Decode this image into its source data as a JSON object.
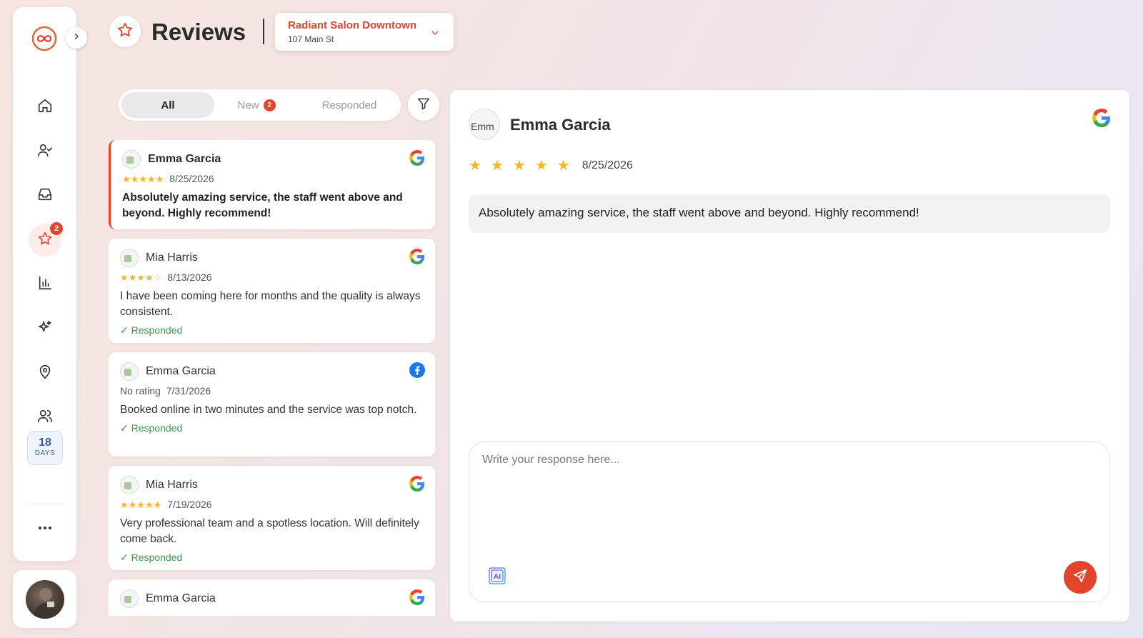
{
  "sidebar": {
    "items": [
      {
        "name": "home",
        "icon": "home-icon"
      },
      {
        "name": "contacts",
        "icon": "user-check-icon"
      },
      {
        "name": "inbox",
        "icon": "inbox-icon"
      },
      {
        "name": "reviews",
        "icon": "star-icon",
        "badge": "2",
        "active": true
      },
      {
        "name": "analytics",
        "icon": "bar-chart-icon"
      },
      {
        "name": "ai",
        "icon": "sparkles-icon"
      },
      {
        "name": "locations",
        "icon": "map-pin-icon"
      },
      {
        "name": "team",
        "icon": "users-icon"
      }
    ],
    "trial_days": "18",
    "trial_days_label": "DAYS",
    "more_icon": "more-horizontal-icon"
  },
  "header": {
    "title": "Reviews",
    "icon": "star-icon",
    "location": {
      "name": "Radiant Salon Downtown",
      "address": "107 Main St"
    }
  },
  "tabs": [
    {
      "label": "All",
      "active": true
    },
    {
      "label": "New",
      "badge": "2"
    },
    {
      "label": "Responded"
    }
  ],
  "reviews": [
    {
      "name": "Emma Garcia",
      "platform": "google",
      "rating": 5,
      "date": "8/25/2026",
      "text": "Absolutely amazing service, the staff went above and beyond. Highly recommend!",
      "responded": false,
      "selected": true
    },
    {
      "name": "Mia Harris",
      "platform": "google",
      "rating": 4,
      "date": "8/13/2026",
      "text": "I have been coming here for months and the quality is always consistent.",
      "responded": true,
      "status": "Responded"
    },
    {
      "name": "Emma Garcia",
      "platform": "facebook",
      "rating": null,
      "rating_text": "No rating",
      "date": "7/31/2026",
      "text": "Booked online in two minutes and the service was top notch.",
      "responded": true,
      "status": "Responded"
    },
    {
      "name": "Mia Harris",
      "platform": "google",
      "rating": 5,
      "date": "7/19/2026",
      "text": "Very professional team and a spotless location. Will definitely come back.",
      "responded": true,
      "status": "Responded"
    },
    {
      "name": "Emma Garcia",
      "platform": "google"
    }
  ],
  "detail": {
    "avatar_alt": "Emm",
    "name": "Emma Garcia",
    "platform": "google",
    "rating": 5,
    "date": "8/25/2026",
    "text": "Absolutely amazing service, the staff went above and beyond. Highly recommend!",
    "response_placeholder": "Write your response here...",
    "ai_label": "AI"
  },
  "colors": {
    "accent": "#e2452c",
    "star": "#f4b72a",
    "responded": "#3b9a4e",
    "trial": "#2f5fb6"
  }
}
